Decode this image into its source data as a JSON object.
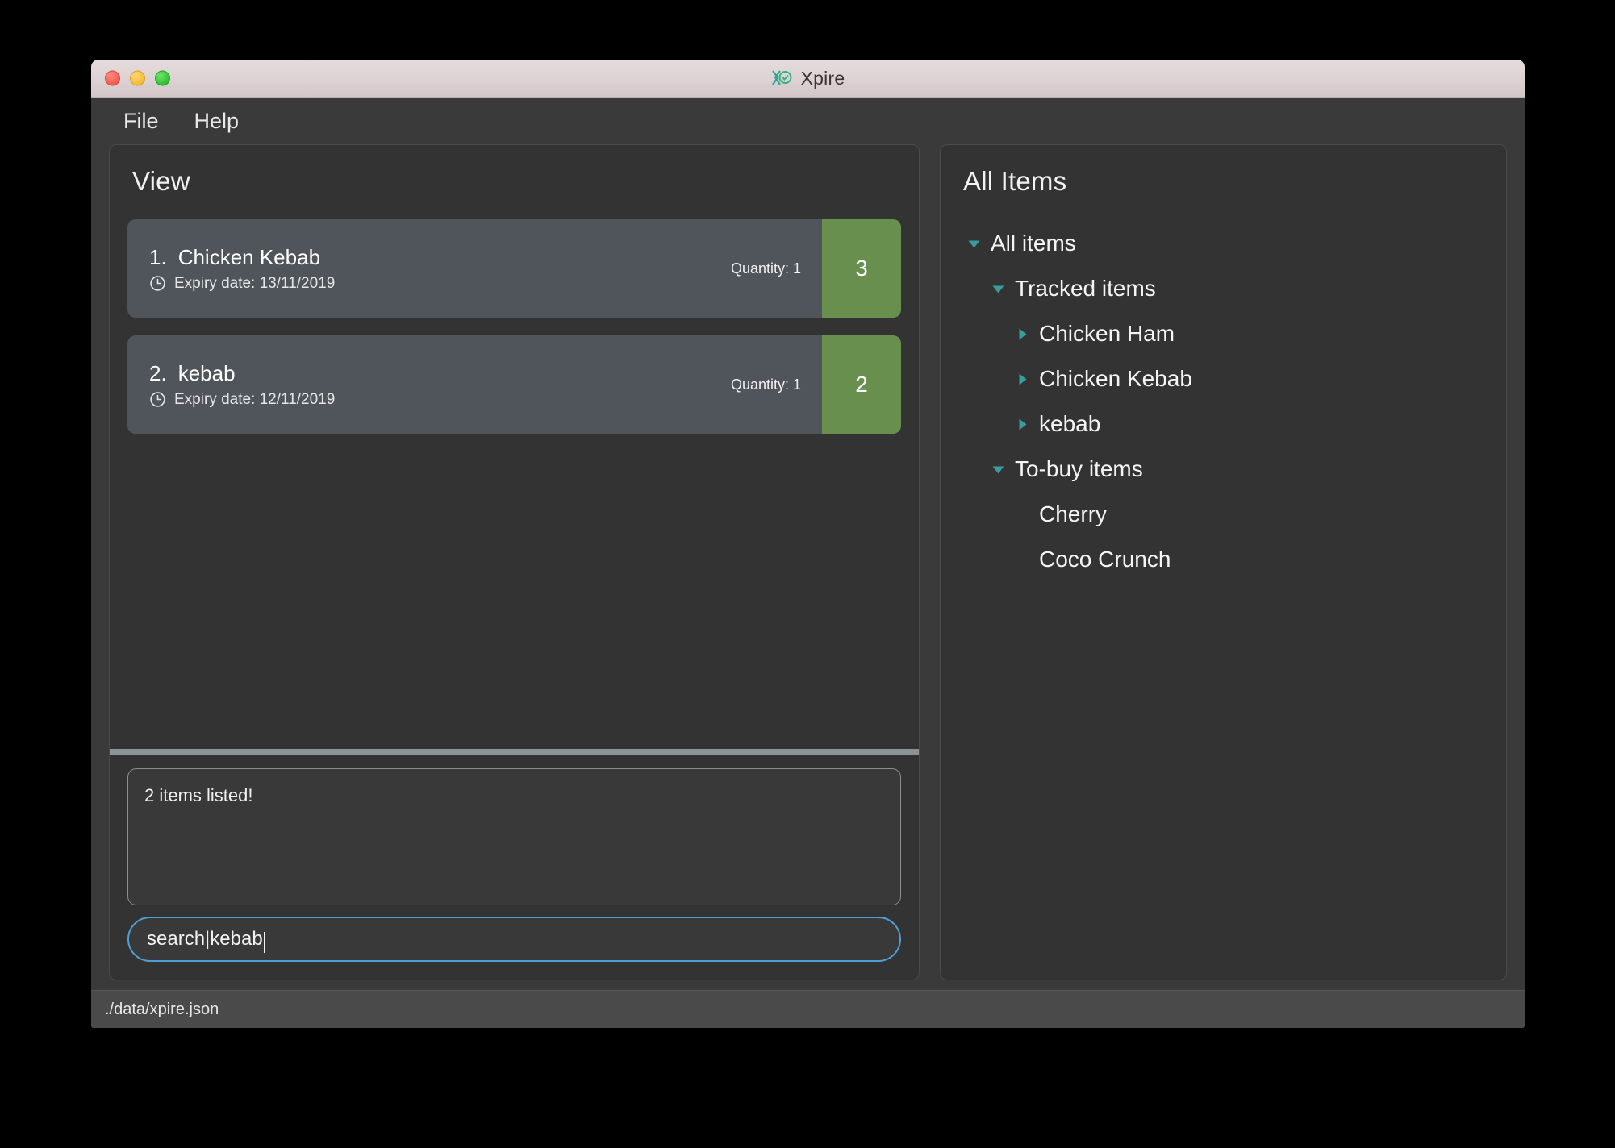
{
  "window": {
    "title": "Xpire",
    "logo_icon": "xpire-logo-icon",
    "traffic_lights": [
      {
        "name": "close-button",
        "color": "#f35b52"
      },
      {
        "name": "minimize-button",
        "color": "#f7bb35"
      },
      {
        "name": "maximize-button",
        "color": "#2fc22f"
      }
    ]
  },
  "menubar": {
    "items": [
      {
        "label": "File"
      },
      {
        "label": "Help"
      }
    ]
  },
  "view_panel": {
    "title": "View",
    "quantity_prefix": "Quantity: ",
    "clock_icon": "clock-icon",
    "items": [
      {
        "index": "1.",
        "name": "Chicken Kebab",
        "expiry_label": "Expiry date: 13/11/2019",
        "quantity": "Quantity: 1",
        "badge": "3",
        "badge_color": "#688f4d"
      },
      {
        "index": "2.",
        "name": "kebab",
        "expiry_label": "Expiry date: 12/11/2019",
        "quantity": "Quantity: 1",
        "badge": "2",
        "badge_color": "#688f4d"
      }
    ]
  },
  "result_box": {
    "text": "2 items listed!"
  },
  "search": {
    "value": "search|kebab",
    "placeholder": "",
    "border_color": "#4f9fd4"
  },
  "all_items_panel": {
    "title": "All Items",
    "arrow_color": "#3a9d9d",
    "tree": [
      {
        "label": "All items",
        "depth": 0,
        "arrow": "expanded"
      },
      {
        "label": "Tracked items",
        "depth": 1,
        "arrow": "expanded"
      },
      {
        "label": "Chicken Ham",
        "depth": 2,
        "arrow": "collapsed"
      },
      {
        "label": "Chicken Kebab",
        "depth": 2,
        "arrow": "collapsed"
      },
      {
        "label": "kebab",
        "depth": 2,
        "arrow": "collapsed"
      },
      {
        "label": "To-buy items",
        "depth": 1,
        "arrow": "expanded"
      },
      {
        "label": "Cherry",
        "depth": 2,
        "arrow": "none"
      },
      {
        "label": "Coco Crunch",
        "depth": 2,
        "arrow": "none"
      }
    ]
  },
  "statusbar": {
    "path": "./data/xpire.json"
  }
}
